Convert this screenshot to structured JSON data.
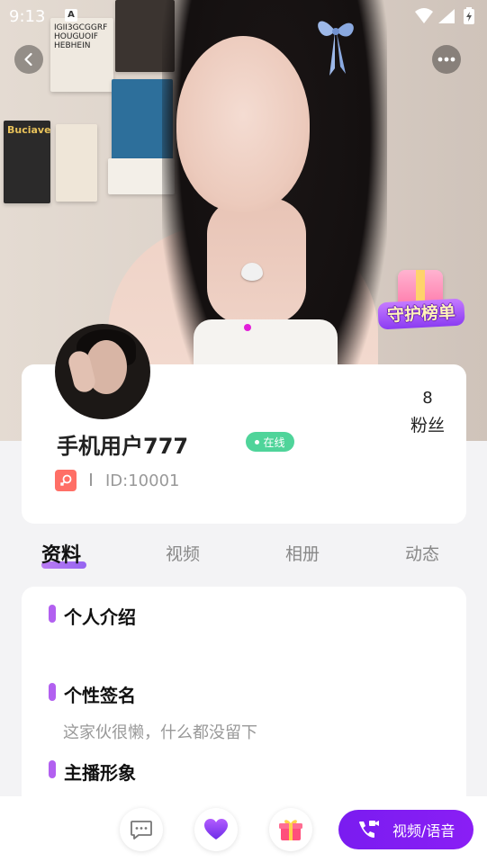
{
  "status_bar": {
    "time": "9:13",
    "notification_letter": "A",
    "icons": [
      "wifi-icon",
      "signal-icon",
      "battery-charging-icon"
    ]
  },
  "hero": {
    "poster_text_1": "IGII3GCGGRF HOUGUOIF HEBHEIN",
    "poster_text_2": "Buciave",
    "guard_rank_label": "守护榜单",
    "carousel_indicator_color": "#e21fd9"
  },
  "nav": {
    "back_icon": "chevron-left-icon",
    "more_icon": "more-horizontal-icon"
  },
  "profile": {
    "username": "手机用户777",
    "online_status": "在线",
    "user_id": "ID:10001",
    "fans_count": "8",
    "fans_label": "粉丝",
    "gender_icon": "female-icon",
    "online_color": "#4fd49a"
  },
  "tabs": [
    {
      "label": "资料",
      "active": true
    },
    {
      "label": "视频",
      "active": false
    },
    {
      "label": "相册",
      "active": false
    },
    {
      "label": "动态",
      "active": false
    }
  ],
  "info": {
    "sections": [
      {
        "title": "个人介绍",
        "body": ""
      },
      {
        "title": "个性签名",
        "body": "这家伙很懒，什么都没留下"
      },
      {
        "title": "主播形象",
        "body": ""
      }
    ],
    "accent_color": "#b260f0"
  },
  "bottom_bar": {
    "buttons": [
      {
        "name": "message-icon"
      },
      {
        "name": "heart-icon"
      },
      {
        "name": "gift-icon"
      }
    ],
    "call_label": "视频/语音",
    "call_color": "#7a1cf0"
  }
}
